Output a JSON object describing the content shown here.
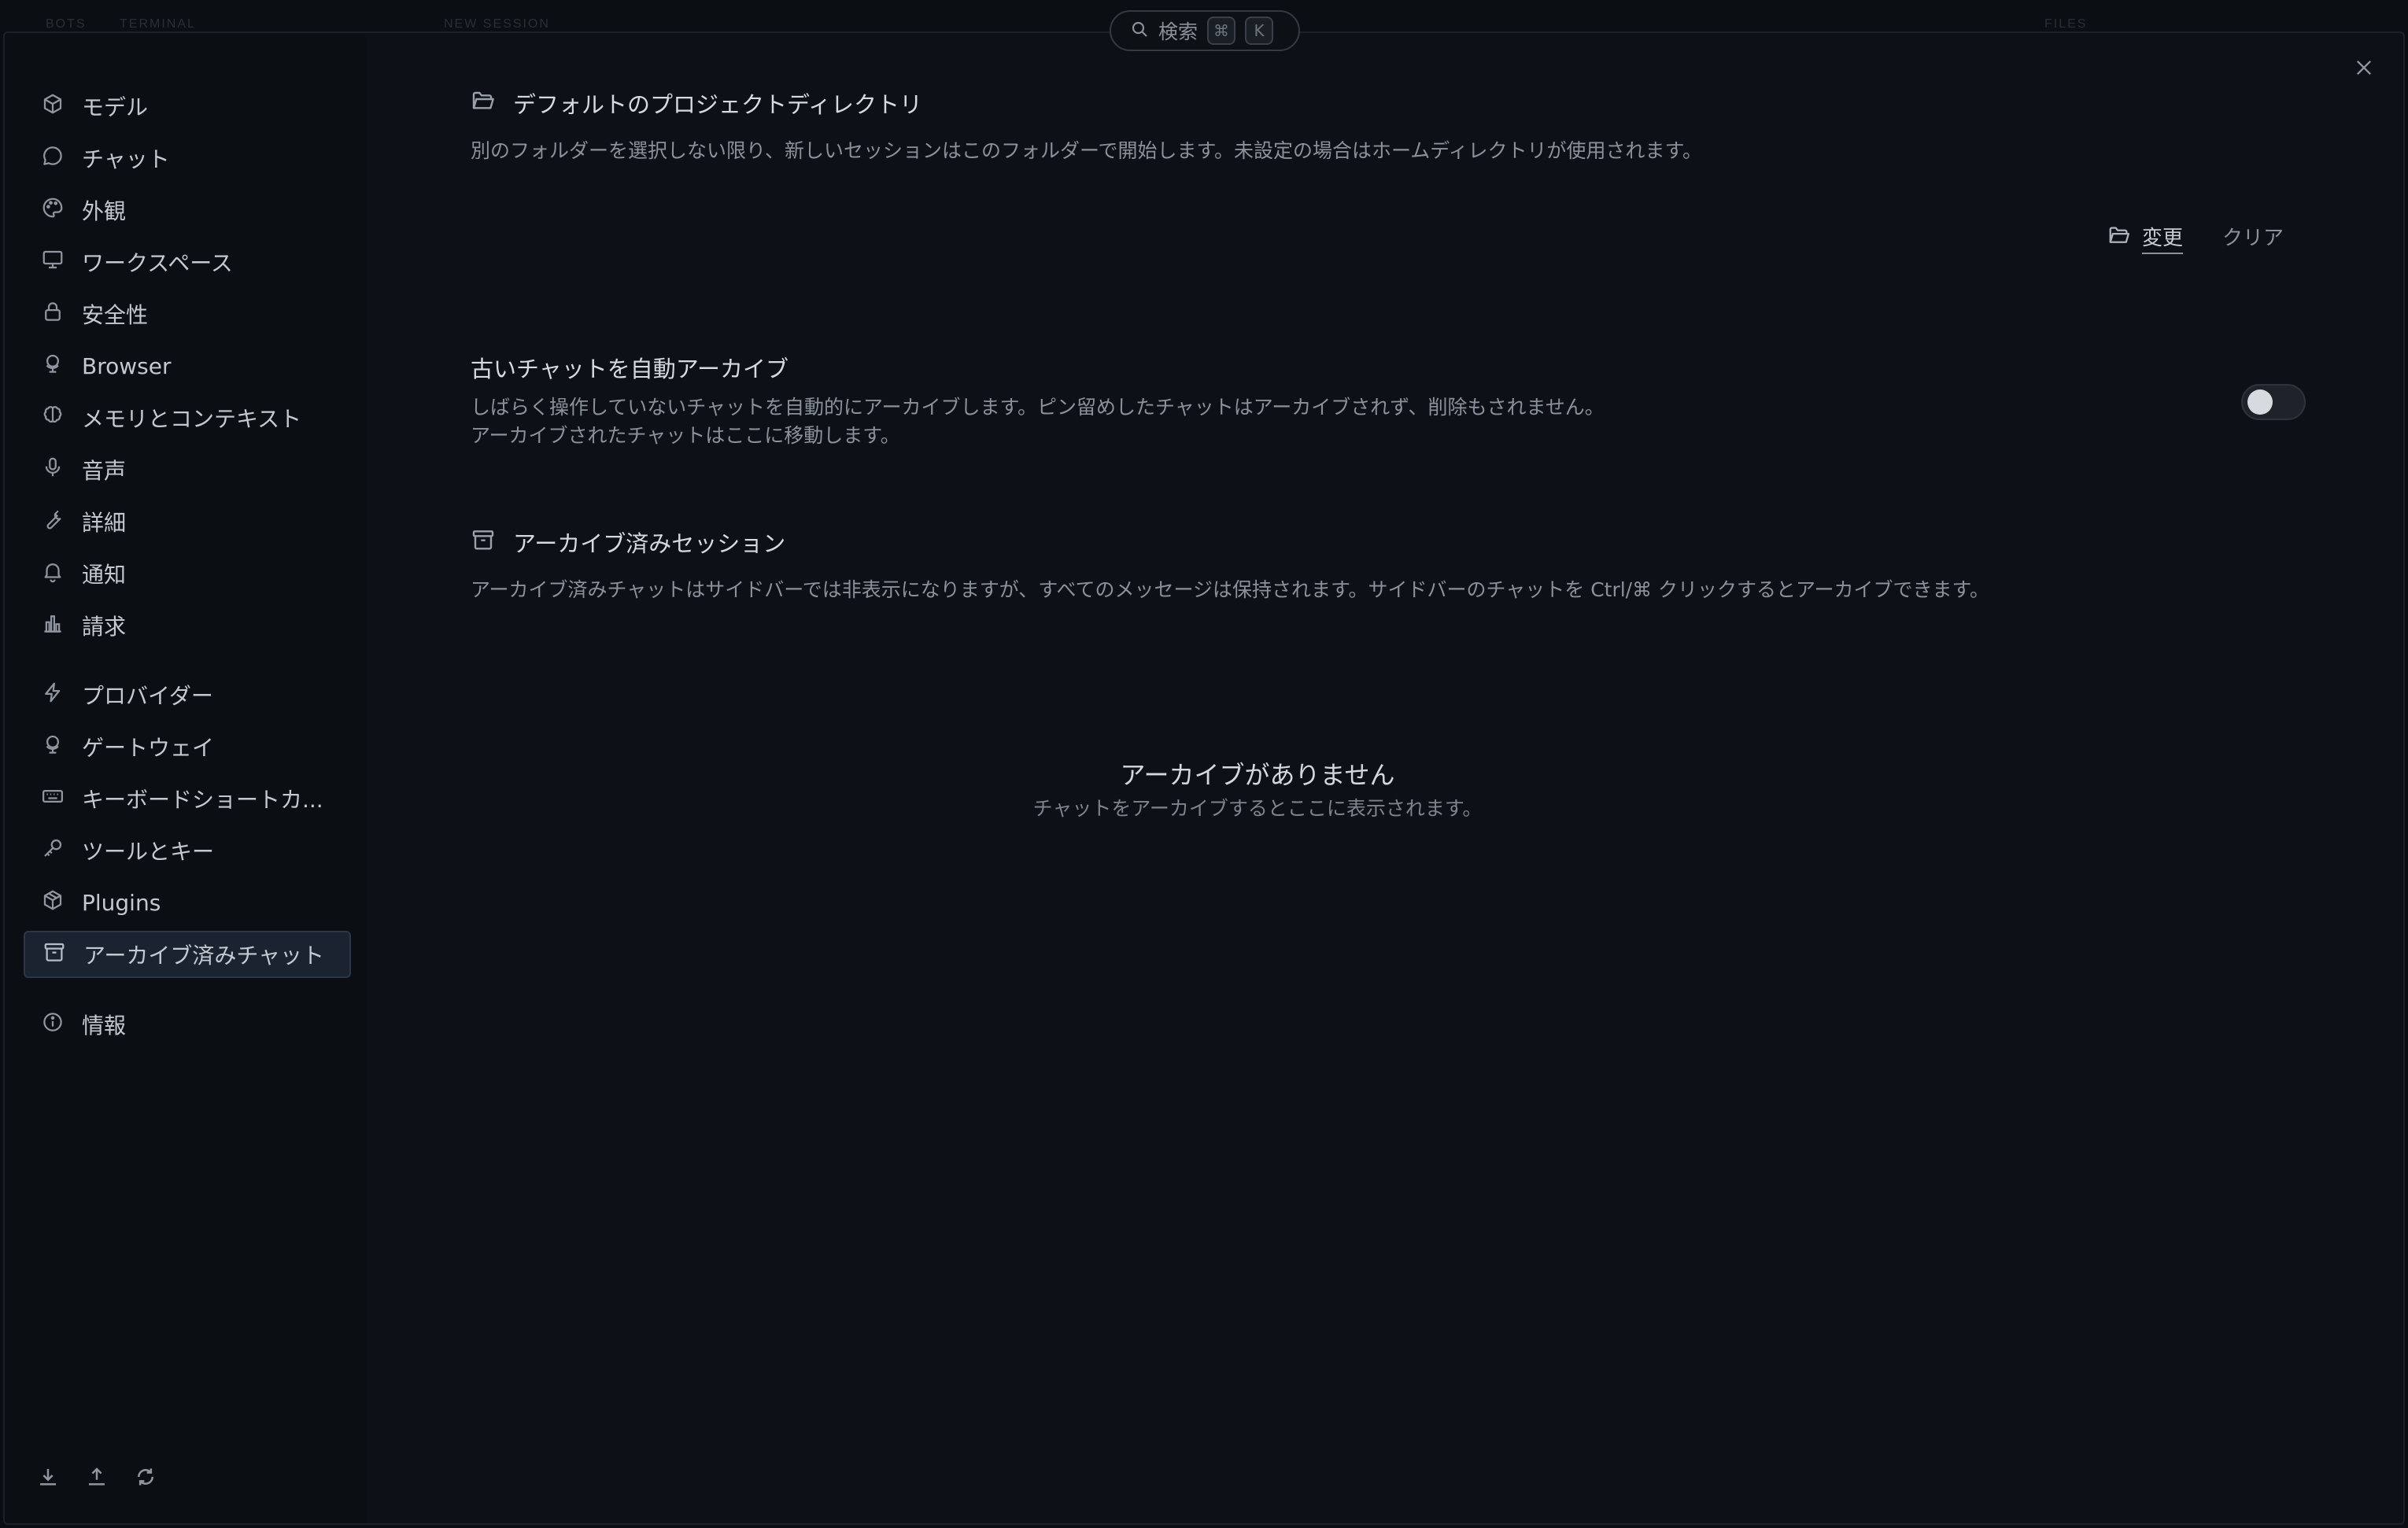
{
  "topbar": {
    "ghost_tabs": [
      "BOTS",
      "TERMINAL",
      "NEW SESSION",
      "FILES"
    ],
    "search": {
      "label": "検索",
      "key_cmd": "⌘",
      "key_k": "K"
    }
  },
  "sidebar": {
    "items": [
      {
        "label": "モデル",
        "icon": "cube-icon"
      },
      {
        "label": "チャット",
        "icon": "chat-bubble-icon"
      },
      {
        "label": "外観",
        "icon": "palette-icon"
      },
      {
        "label": "ワークスペース",
        "icon": "monitor-icon"
      },
      {
        "label": "安全性",
        "icon": "lock-icon"
      },
      {
        "label": "Browser",
        "icon": "globe-stand-icon"
      },
      {
        "label": "メモリとコンテキスト",
        "icon": "brain-icon"
      },
      {
        "label": "音声",
        "icon": "microphone-icon"
      },
      {
        "label": "詳細",
        "icon": "wrench-icon"
      },
      {
        "label": "通知",
        "icon": "bell-icon"
      },
      {
        "label": "請求",
        "icon": "bar-chart-icon"
      },
      {
        "label": "プロバイダー",
        "icon": "lightning-icon"
      },
      {
        "label": "ゲートウェイ",
        "icon": "globe-stand-icon"
      },
      {
        "label": "キーボードショートカ...",
        "icon": "keyboard-icon"
      },
      {
        "label": "ツールとキー",
        "icon": "key-icon"
      },
      {
        "label": "Plugins",
        "icon": "package-icon"
      },
      {
        "label": "アーカイブ済みチャット",
        "icon": "archive-icon",
        "active": true
      },
      {
        "label": "情報",
        "icon": "info-icon"
      }
    ],
    "footer_icons": [
      "download-icon",
      "upload-icon",
      "refresh-icon"
    ]
  },
  "main": {
    "project_dir": {
      "title": "デフォルトのプロジェクトディレクトリ",
      "description": "別のフォルダーを選択しない限り、新しいセッションはこのフォルダーで開始します。未設定の場合はホームディレクトリが使用されます。",
      "change_label": "変更",
      "clear_label": "クリア"
    },
    "auto_archive": {
      "title": "古いチャットを自動アーカイブ",
      "description_line1": "しばらく操作していないチャットを自動的にアーカイブします。ピン留めしたチャットはアーカイブされず、削除もされません。",
      "description_line2": "アーカイブされたチャットはここに移動します。",
      "enabled": false
    },
    "archived_sessions": {
      "title": "アーカイブ済みセッション",
      "description": "アーカイブ済みチャットはサイドバーでは非表示になりますが、すべてのメッセージは保持されます。サイドバーのチャットを Ctrl/⌘ クリックするとアーカイブできます。",
      "empty_title": "アーカイブがありません",
      "empty_subtitle": "チャットをアーカイブするとここに表示されます。"
    }
  },
  "colors": {
    "background": "#0d1117",
    "sidebar": "#0b0e13",
    "active_item": "#1b2330",
    "text_primary": "#d5dae1",
    "text_secondary": "#8a919b"
  }
}
